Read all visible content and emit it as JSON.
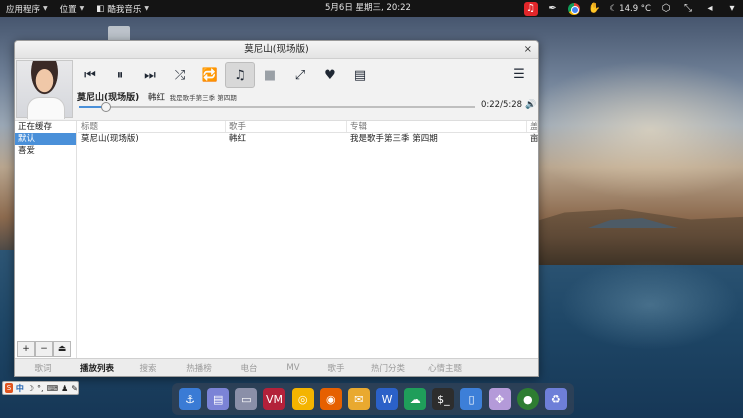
{
  "top_panel": {
    "applications": "应用程序",
    "places": "位置",
    "app_name": "酷我音乐",
    "clock": "5月6日 星期三, 20:22",
    "weather": "14.9 °C"
  },
  "window": {
    "title": "莫尼山(现场版)",
    "close": "×"
  },
  "player": {
    "song_title": "莫尼山(现场版)",
    "artist": "韩红",
    "album_small": "我是歌手第三季 第四期",
    "position": "0:22",
    "duration": "5:28",
    "time_display": "0:22/5:28",
    "progress_fraction": 0.067,
    "active_color": "#4a90d9"
  },
  "controls": {
    "prev": "⏮",
    "pause": "⏸",
    "next": "⏭",
    "shuffle": "⤮",
    "repeat": "🔁",
    "music": "♫",
    "video": "■",
    "fullscreen": "⤢",
    "favorite": "♥",
    "lyrics": "▤",
    "menu": "☰",
    "volume": "🔊"
  },
  "sidebar": {
    "items": [
      "正在缓存",
      "默认",
      "喜爱"
    ],
    "selected_index": 1,
    "buttons": [
      "+",
      "−",
      "⏏"
    ]
  },
  "playlist": {
    "headers": [
      "标题",
      "歌手",
      "专辑",
      "盖"
    ],
    "rows": [
      {
        "title": "莫尼山(现场版)",
        "artist": "韩红",
        "album": "我是歌手第三季 第四期",
        "extra": "亩"
      }
    ]
  },
  "tabs": [
    "歌词",
    "播放列表",
    "搜索",
    "热播榜",
    "电台",
    "MV",
    "歌手",
    "热门分类",
    "心情主题"
  ],
  "active_tab_index": 1,
  "im_bar": {
    "brand": "S",
    "lang": "中"
  },
  "dock": {
    "apps": [
      {
        "name": "anchor",
        "glyph": "⚓",
        "color": "#3a7bd5"
      },
      {
        "name": "notes",
        "glyph": "▤",
        "color": "#7b83d6"
      },
      {
        "name": "files",
        "glyph": "▭",
        "color": "#8a8fa8"
      },
      {
        "name": "wps",
        "glyph": "VM",
        "color": "#b3213a"
      },
      {
        "name": "chrome",
        "glyph": "◎",
        "color": "#f4b400"
      },
      {
        "name": "firefox",
        "glyph": "◉",
        "color": "#e66000"
      },
      {
        "name": "mail",
        "glyph": "✉",
        "color": "#e9a92f"
      },
      {
        "name": "word",
        "glyph": "W",
        "color": "#2b61c8"
      },
      {
        "name": "cloud",
        "glyph": "☁",
        "color": "#1f9e5a"
      },
      {
        "name": "terminal",
        "glyph": "$_",
        "color": "#2d2d2d"
      },
      {
        "name": "document",
        "glyph": "▯",
        "color": "#3d7fd8"
      },
      {
        "name": "puzzle",
        "glyph": "✥",
        "color": "#b49ad9"
      },
      {
        "name": "ball",
        "glyph": "●",
        "color": "#2e7d32"
      },
      {
        "name": "recycle",
        "glyph": "♻",
        "color": "#6e7fd8"
      }
    ]
  }
}
